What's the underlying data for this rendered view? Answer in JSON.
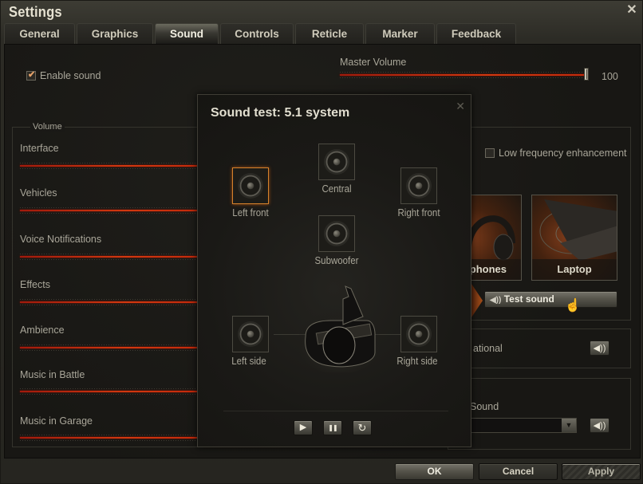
{
  "window": {
    "title": "Settings",
    "close_icon": "close-icon"
  },
  "tabs": [
    {
      "label": "General",
      "active": false
    },
    {
      "label": "Graphics",
      "active": false
    },
    {
      "label": "Sound",
      "active": true
    },
    {
      "label": "Controls",
      "active": false
    },
    {
      "label": "Reticle",
      "active": false
    },
    {
      "label": "Marker",
      "active": false
    },
    {
      "label": "Feedback",
      "active": false
    }
  ],
  "sound": {
    "enable_sound": {
      "label": "Enable sound",
      "checked": true
    },
    "master_volume": {
      "label": "Master Volume",
      "value": 100,
      "value_text": "100"
    },
    "volume_group": {
      "legend": "Volume",
      "sliders": [
        {
          "label": "Interface"
        },
        {
          "label": "Vehicles"
        },
        {
          "label": "Voice Notifications"
        },
        {
          "label": "Effects"
        },
        {
          "label": "Ambience"
        },
        {
          "label": "Music in Battle"
        },
        {
          "label": "Music in Garage"
        }
      ]
    },
    "low_frequency": {
      "label": "Low frequency enhancement",
      "checked": false
    },
    "presets": [
      {
        "label": "phones",
        "icon": "headphones-icon"
      },
      {
        "label": "Laptop",
        "icon": "laptop-icon"
      }
    ],
    "test_sound_button": {
      "label": "Test sound",
      "icon": "speaker-icon"
    },
    "partial_label_1": "ational",
    "partial_label_2": "Sound",
    "speaker_button_icon": "🔊"
  },
  "modal": {
    "title": "Sound test: 5.1 system",
    "speakers": [
      {
        "id": "left-front",
        "label": "Left front",
        "active": true
      },
      {
        "id": "central",
        "label": "Central",
        "active": false
      },
      {
        "id": "right-front",
        "label": "Right front",
        "active": false
      },
      {
        "id": "subwoofer",
        "label": "Subwoofer",
        "active": false
      },
      {
        "id": "left-side",
        "label": "Left side",
        "active": false
      },
      {
        "id": "right-side",
        "label": "Right side",
        "active": false
      }
    ],
    "controls": {
      "play": "▶",
      "pause": "❚❚",
      "replay": "↻"
    }
  },
  "footer": {
    "ok_label": "OK",
    "cancel_label": "Cancel",
    "apply_label": "Apply"
  },
  "colors": {
    "accent_red": "#c32a0b",
    "active_speaker_border": "#d6822c",
    "checkbox_tick": "#e6a36a"
  }
}
